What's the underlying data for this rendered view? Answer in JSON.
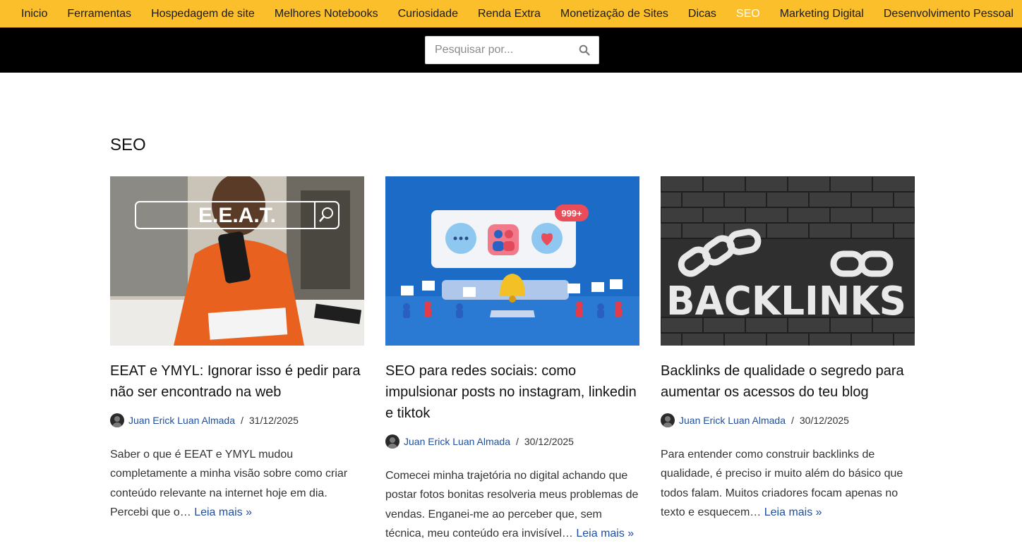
{
  "nav": {
    "items": [
      {
        "label": "Inicio"
      },
      {
        "label": "Ferramentas"
      },
      {
        "label": "Hospedagem de site"
      },
      {
        "label": "Melhores Notebooks"
      },
      {
        "label": "Curiosidade"
      },
      {
        "label": "Renda Extra"
      },
      {
        "label": "Monetização de Sites"
      },
      {
        "label": "Dicas"
      },
      {
        "label": "SEO"
      },
      {
        "label": "Marketing Digital"
      },
      {
        "label": "Desenvolvimento Pessoal"
      }
    ],
    "active": "SEO",
    "bg_color": "#fbbf2c"
  },
  "search": {
    "placeholder": "Pesquisar por...",
    "icon": "search-icon"
  },
  "archive": {
    "title": "SEO"
  },
  "posts": [
    {
      "title": "EEAT e YMYL: Ignorar isso é pedir para não ser encontrado na web",
      "author": "Juan Erick Luan Almada",
      "sep": "/",
      "date": "31/12/2025",
      "excerpt": "Saber o que é EEAT e YMYL mudou completamente a minha visão sobre como criar conteúdo relevante na internet hoje em dia. Percebi que o…",
      "more": "Leia mais »",
      "image_text": "E.E.A.T."
    },
    {
      "title": "SEO para redes sociais: como impulsionar posts no instagram, linkedin e tiktok",
      "author": "Juan Erick Luan Almada",
      "sep": "/",
      "date": "30/12/2025",
      "excerpt": "Comecei minha trajetória no digital achando que postar fotos bonitas resolveria meus problemas de vendas. Enganei-me ao perceber que, sem técnica, meu conteúdo era invisível…",
      "more": "Leia mais »",
      "image_text": "999+"
    },
    {
      "title": "Backlinks de qualidade o segredo para aumentar os acessos do teu blog",
      "author": "Juan Erick Luan Almada",
      "sep": "/",
      "date": "30/12/2025",
      "excerpt": "Para entender como construir backlinks de qualidade, é preciso ir muito além do básico que todos falam. Muitos criadores focam apenas no texto e esquecem…",
      "more": "Leia mais »",
      "image_text": "BACKLINKS"
    }
  ]
}
